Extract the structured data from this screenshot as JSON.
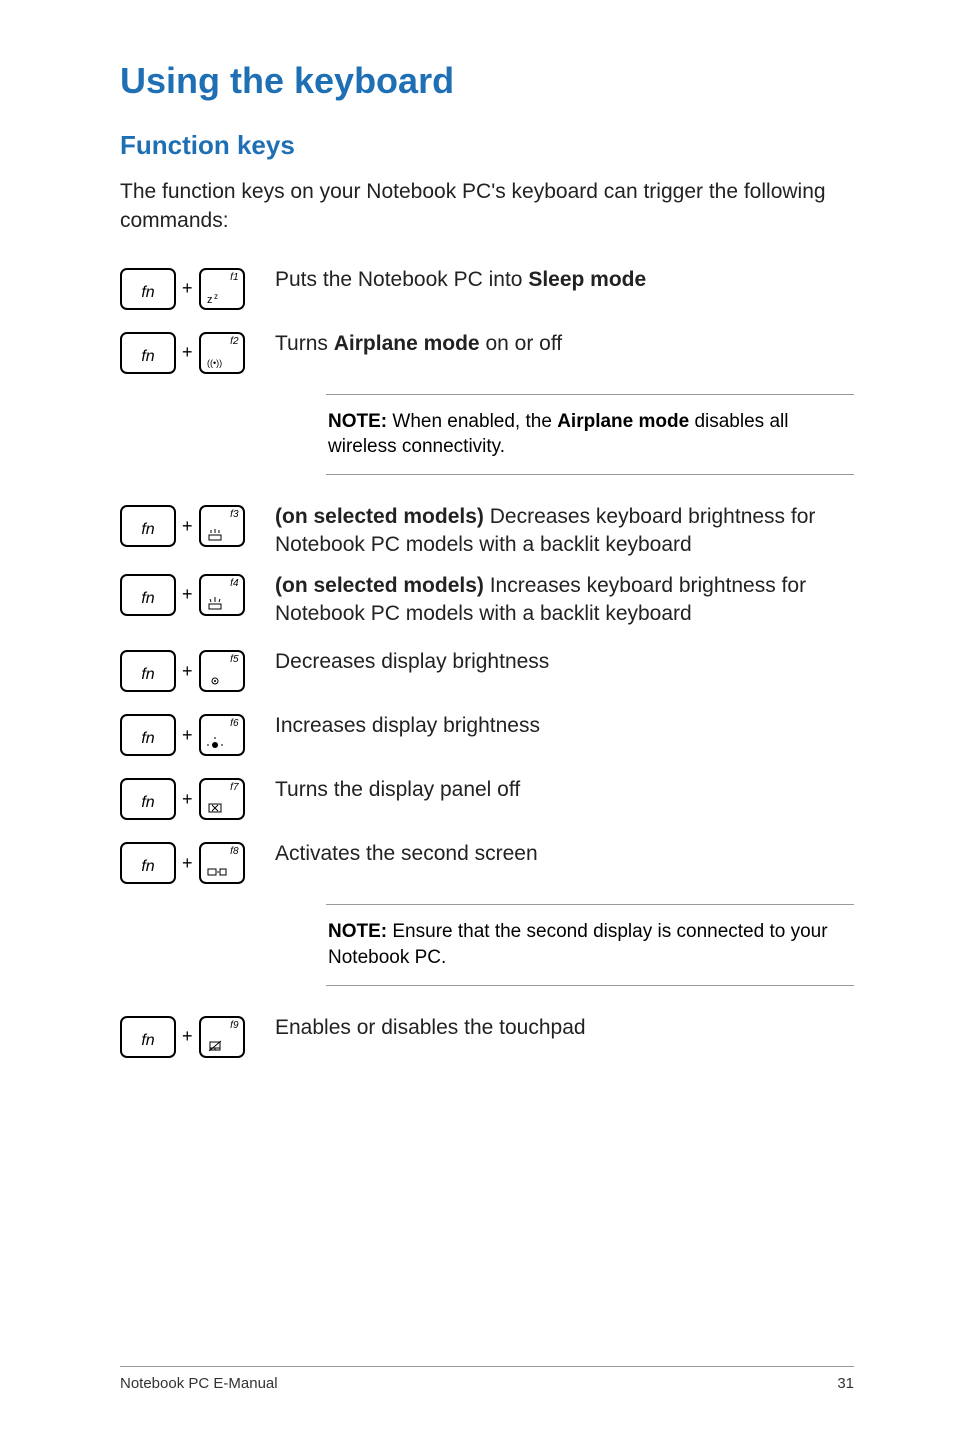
{
  "title": "Using the keyboard",
  "section": "Function keys",
  "intro": "The function keys on your Notebook PC's keyboard can trigger the following commands:",
  "keys": {
    "fn": "fn",
    "f1": "f1",
    "f2": "f2",
    "f3": "f3",
    "f4": "f4",
    "f5": "f5",
    "f6": "f6",
    "f7": "f7",
    "f8": "f8",
    "f9": "f9"
  },
  "rows": {
    "r1": {
      "pre": "Puts the Notebook PC into ",
      "bold": "Sleep mode"
    },
    "r2": {
      "pre": "Turns ",
      "bold": "Airplane mode",
      "post": " on or off"
    },
    "r3": {
      "bold": "(on selected models)",
      "post": " Decreases keyboard brightness for Notebook PC models with a backlit keyboard"
    },
    "r4": {
      "bold": "(on selected models)",
      "post": " Increases keyboard brightness for Notebook PC models with a backlit keyboard"
    },
    "r5": "Decreases display brightness",
    "r6": "Increases display brightness",
    "r7": "Turns the display panel off",
    "r8": "Activates the second screen",
    "r9": "Enables or disables the touchpad"
  },
  "notes": {
    "n1_bold1": "NOTE:",
    "n1_mid": " When enabled, the ",
    "n1_bold2": "Airplane mode",
    "n1_post": " disables all wireless connectivity.",
    "n2_bold": "NOTE:",
    "n2_post": " Ensure that the second display is connected to your Notebook PC."
  },
  "footer": {
    "left": "Notebook PC E-Manual",
    "right": "31"
  },
  "glyphs": {
    "f1": "z",
    "f1b": "z",
    "airplane": "((•))"
  }
}
